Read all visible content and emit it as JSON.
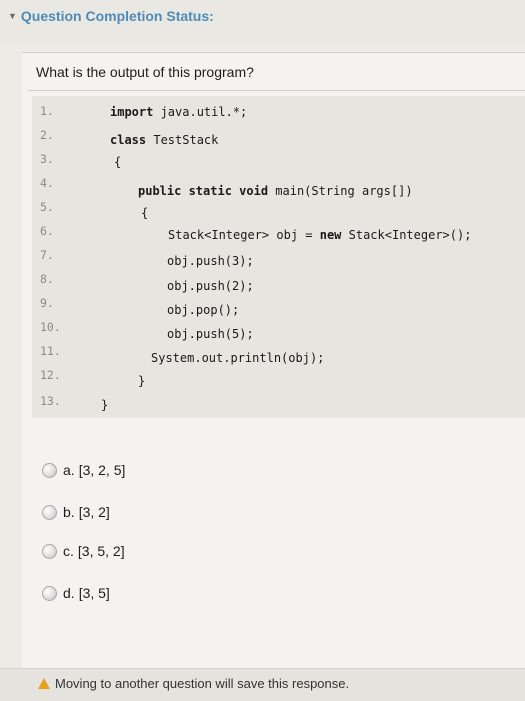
{
  "header": {
    "title": "Question Completion Status:",
    "chevron_icon": "chevron-down-icon"
  },
  "question": {
    "prompt": "What is the output of this program?"
  },
  "code": {
    "line_numbers": [
      "1.",
      "2.",
      "3.",
      "4.",
      "5.",
      "6.",
      "7.",
      "8.",
      "9.",
      "10.",
      "11.",
      "12.",
      "13."
    ],
    "lines": {
      "l1_kw": "import",
      "l1_rest": " java.util.*;",
      "l2_kw": "class",
      "l2_rest": " TestStack",
      "l3": "{",
      "l4_kw": "public static void",
      "l4_rest": " main(String args[])",
      "l5": "{",
      "l6_a": "Stack<Integer> obj = ",
      "l6_kw": "new",
      "l6_b": " Stack<Integer>();",
      "l7": "obj.push(3);",
      "l8": "obj.push(2);",
      "l9": "obj.pop();",
      "l10": "obj.push(5);",
      "l11": "System.out.println(obj);",
      "l12": "}",
      "l13": "}"
    }
  },
  "options": [
    {
      "letter": "a.",
      "text": "[3, 2, 5]"
    },
    {
      "letter": "b.",
      "text": "[3, 2]"
    },
    {
      "letter": "c.",
      "text": "[3, 5, 2]"
    },
    {
      "letter": "d.",
      "text": "[3, 5]"
    }
  ],
  "footer": {
    "note": "Moving to another question will save this response.",
    "warning_icon": "warning-icon",
    "warning_color": "#e8a020"
  },
  "colors": {
    "header_text": "#4e8bb8",
    "background": "#ecebe6"
  }
}
